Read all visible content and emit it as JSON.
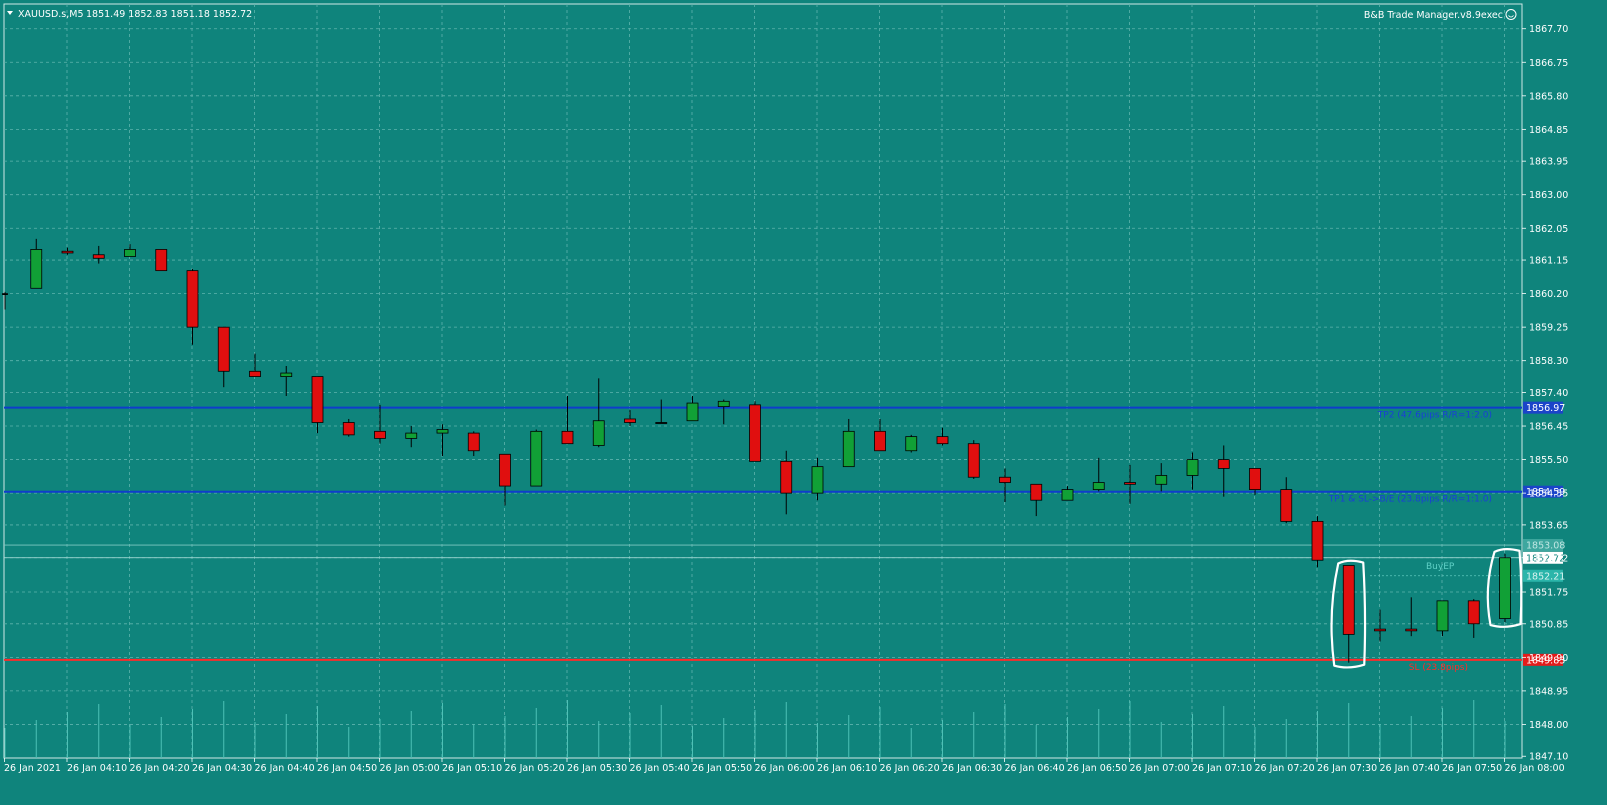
{
  "header": {
    "symbol": "XAUUSD.s,M5",
    "ohlc": "1851.49 1852.83 1851.18 1852.72"
  },
  "expert": {
    "name": "B&B Trade Manager.v8.9exec"
  },
  "colors": {
    "background": "#0f847c",
    "grid": "#5fb3ad",
    "bull": "#11a036",
    "bear": "#e00f0f",
    "wick": "#000000",
    "tp_line": "#0f3ccc",
    "sl_line": "#ff2a2a",
    "annotation": "#ffffff"
  },
  "chart_data": {
    "type": "candlestick",
    "y_range": [
      1847.05,
      1868.4
    ],
    "y_ticks": [
      "1867.70",
      "1866.75",
      "1865.80",
      "1864.85",
      "1863.95",
      "1863.00",
      "1862.05",
      "1861.15",
      "1860.20",
      "1859.25",
      "1858.30",
      "1857.40",
      "1856.45",
      "1855.50",
      "1854.55",
      "1853.65",
      "1852.72",
      "1851.75",
      "1850.85",
      "1849.90",
      "1848.95",
      "1848.00",
      "1847.10"
    ],
    "x_labels": [
      "26 Jan 2021",
      "26 Jan 04:10",
      "26 Jan 04:20",
      "26 Jan 04:30",
      "26 Jan 04:40",
      "26 Jan 04:50",
      "26 Jan 05:00",
      "26 Jan 05:10",
      "26 Jan 05:20",
      "26 Jan 05:30",
      "26 Jan 05:40",
      "26 Jan 05:50",
      "26 Jan 06:00",
      "26 Jan 06:10",
      "26 Jan 06:20",
      "26 Jan 06:30",
      "26 Jan 06:40",
      "26 Jan 06:50",
      "26 Jan 07:00",
      "26 Jan 07:10",
      "26 Jan 07:20",
      "26 Jan 07:30",
      "26 Jan 07:40",
      "26 Jan 07:50",
      "26 Jan 08:00"
    ],
    "candles": [
      {
        "o": 1860.2,
        "h": 1860.25,
        "l": 1859.75,
        "c": 1860.2
      },
      {
        "o": 1860.35,
        "h": 1861.75,
        "l": 1860.35,
        "c": 1861.45
      },
      {
        "o": 1861.4,
        "h": 1861.5,
        "l": 1861.3,
        "c": 1861.35
      },
      {
        "o": 1861.3,
        "h": 1861.55,
        "l": 1861.05,
        "c": 1861.2
      },
      {
        "o": 1861.25,
        "h": 1861.6,
        "l": 1861.25,
        "c": 1861.45
      },
      {
        "o": 1861.45,
        "h": 1861.45,
        "l": 1860.85,
        "c": 1860.85
      },
      {
        "o": 1860.85,
        "h": 1860.9,
        "l": 1858.75,
        "c": 1859.25
      },
      {
        "o": 1859.25,
        "h": 1859.25,
        "l": 1857.55,
        "c": 1858.0
      },
      {
        "o": 1858.0,
        "h": 1858.5,
        "l": 1857.85,
        "c": 1857.85
      },
      {
        "o": 1857.85,
        "h": 1858.15,
        "l": 1857.3,
        "c": 1857.95
      },
      {
        "o": 1857.85,
        "h": 1857.85,
        "l": 1856.25,
        "c": 1856.55
      },
      {
        "o": 1856.55,
        "h": 1856.65,
        "l": 1856.15,
        "c": 1856.2
      },
      {
        "o": 1856.3,
        "h": 1857.05,
        "l": 1855.95,
        "c": 1856.1
      },
      {
        "o": 1856.1,
        "h": 1856.45,
        "l": 1855.85,
        "c": 1856.25
      },
      {
        "o": 1856.25,
        "h": 1856.5,
        "l": 1855.6,
        "c": 1856.35
      },
      {
        "o": 1856.25,
        "h": 1856.3,
        "l": 1855.6,
        "c": 1855.75
      },
      {
        "o": 1855.65,
        "h": 1855.65,
        "l": 1854.2,
        "c": 1854.75
      },
      {
        "o": 1854.75,
        "h": 1856.35,
        "l": 1854.75,
        "c": 1856.3
      },
      {
        "o": 1856.3,
        "h": 1857.3,
        "l": 1855.95,
        "c": 1855.95
      },
      {
        "o": 1855.9,
        "h": 1857.8,
        "l": 1855.85,
        "c": 1856.6
      },
      {
        "o": 1856.65,
        "h": 1856.9,
        "l": 1856.45,
        "c": 1856.55
      },
      {
        "o": 1856.55,
        "h": 1857.2,
        "l": 1856.55,
        "c": 1856.55
      },
      {
        "o": 1856.6,
        "h": 1857.3,
        "l": 1856.6,
        "c": 1857.1
      },
      {
        "o": 1857.0,
        "h": 1857.2,
        "l": 1856.5,
        "c": 1857.15
      },
      {
        "o": 1857.05,
        "h": 1857.15,
        "l": 1855.45,
        "c": 1855.45
      },
      {
        "o": 1855.45,
        "h": 1855.75,
        "l": 1853.95,
        "c": 1854.55
      },
      {
        "o": 1854.55,
        "h": 1855.55,
        "l": 1854.35,
        "c": 1855.3
      },
      {
        "o": 1855.3,
        "h": 1856.65,
        "l": 1855.3,
        "c": 1856.3
      },
      {
        "o": 1856.3,
        "h": 1856.65,
        "l": 1855.75,
        "c": 1855.75
      },
      {
        "o": 1855.75,
        "h": 1856.2,
        "l": 1855.7,
        "c": 1856.15
      },
      {
        "o": 1856.15,
        "h": 1856.4,
        "l": 1855.9,
        "c": 1855.95
      },
      {
        "o": 1855.95,
        "h": 1856.05,
        "l": 1854.95,
        "c": 1855.0
      },
      {
        "o": 1855.0,
        "h": 1855.25,
        "l": 1854.3,
        "c": 1854.85
      },
      {
        "o": 1854.8,
        "h": 1854.8,
        "l": 1853.9,
        "c": 1854.35
      },
      {
        "o": 1854.35,
        "h": 1854.75,
        "l": 1854.35,
        "c": 1854.65
      },
      {
        "o": 1854.65,
        "h": 1855.55,
        "l": 1854.6,
        "c": 1854.85
      },
      {
        "o": 1854.85,
        "h": 1855.35,
        "l": 1854.25,
        "c": 1854.8
      },
      {
        "o": 1854.8,
        "h": 1855.4,
        "l": 1854.6,
        "c": 1855.05
      },
      {
        "o": 1855.05,
        "h": 1855.7,
        "l": 1854.65,
        "c": 1855.5
      },
      {
        "o": 1855.5,
        "h": 1855.9,
        "l": 1854.45,
        "c": 1855.25
      },
      {
        "o": 1855.25,
        "h": 1855.25,
        "l": 1854.5,
        "c": 1854.65
      },
      {
        "o": 1854.65,
        "h": 1855.0,
        "l": 1853.7,
        "c": 1853.75
      },
      {
        "o": 1853.75,
        "h": 1853.9,
        "l": 1852.45,
        "c": 1852.65
      },
      {
        "o": 1852.5,
        "h": 1852.5,
        "l": 1849.75,
        "c": 1850.55
      },
      {
        "o": 1850.7,
        "h": 1851.25,
        "l": 1850.35,
        "c": 1850.65
      },
      {
        "o": 1850.7,
        "h": 1851.6,
        "l": 1850.5,
        "c": 1850.65
      },
      {
        "o": 1850.65,
        "h": 1851.5,
        "l": 1850.5,
        "c": 1851.5
      },
      {
        "o": 1851.5,
        "h": 1851.55,
        "l": 1850.45,
        "c": 1850.85
      },
      {
        "o": 1851.0,
        "h": 1852.83,
        "l": 1850.9,
        "c": 1852.72
      }
    ],
    "levels": [
      {
        "name": "tp2",
        "price": 1856.97,
        "tag": "1856.97",
        "label": "TP2 (47.6pips R/R=1:2.0)",
        "color": "#0f3ccc"
      },
      {
        "name": "tp1",
        "price": 1854.59,
        "tag": "1854.59",
        "label": "TP1 & SL->B/E (23.8pips R/R=1:1.0)",
        "color": "#0f3ccc"
      },
      {
        "name": "sl",
        "price": 1849.83,
        "tag": "1849.83",
        "label": "SL (23.8pips)",
        "color": "#ff2a2a"
      }
    ],
    "entry": {
      "price": 1852.21,
      "tag": "1852.21",
      "label": "BuyEP"
    },
    "bid": {
      "price": 1852.72,
      "tag": "1852.72"
    },
    "ask": {
      "price": 1853.08,
      "tag": "1853.08"
    }
  }
}
